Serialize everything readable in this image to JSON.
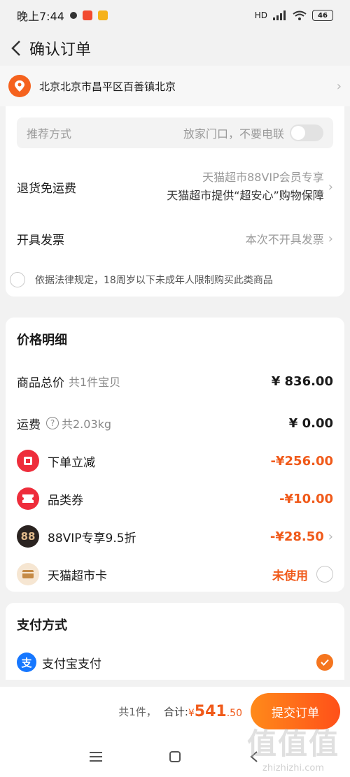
{
  "status_bar": {
    "time": "晚上7:44",
    "battery": "46",
    "network": "HD"
  },
  "header": {
    "title": "确认订单"
  },
  "address": {
    "text": "北京北京市昌平区百善镇北京"
  },
  "delivery": {
    "label": "推荐方式",
    "option": "放家门口，不要电联"
  },
  "return_shipping": {
    "label": "退货免运费",
    "line1": "天猫超市88VIP会员专享",
    "line2": "天猫超市提供“超安心”购物保障"
  },
  "invoice": {
    "label": "开具发票",
    "value": "本次不开具发票"
  },
  "legal": {
    "text": "依据法律规定，18周岁以下未成年人限制购买此类商品"
  },
  "price_detail": {
    "title": "价格明细",
    "goods_total_label": "商品总价",
    "goods_total_sub": "共1件宝贝",
    "goods_total_value": "¥ 836.00",
    "shipping_label": "运费",
    "shipping_sub": "共2.03kg",
    "shipping_value": "¥ 0.00",
    "order_discount_label": "下单立减",
    "order_discount_value": "-¥256.00",
    "category_coupon_label": "品类券",
    "category_coupon_value": "-¥10.00",
    "vip_label": "88VIP专享9.5折",
    "vip_value": "-¥28.50",
    "vip_badge": "88",
    "card_label": "天猫超市卡",
    "card_value": "未使用"
  },
  "payment": {
    "title": "支付方式",
    "method": "支付宝支付",
    "alipay_glyph": "支"
  },
  "bottom": {
    "count": "共1件，",
    "total_label": "合计:",
    "currency": "¥",
    "total_int": "541",
    "total_dec": ".50",
    "submit": "提交订单"
  },
  "watermark": {
    "big": "值值值",
    "small": "zhizhizhi.com"
  },
  "colors": {
    "accent": "#f05a1a",
    "alipay": "#1677ff"
  }
}
